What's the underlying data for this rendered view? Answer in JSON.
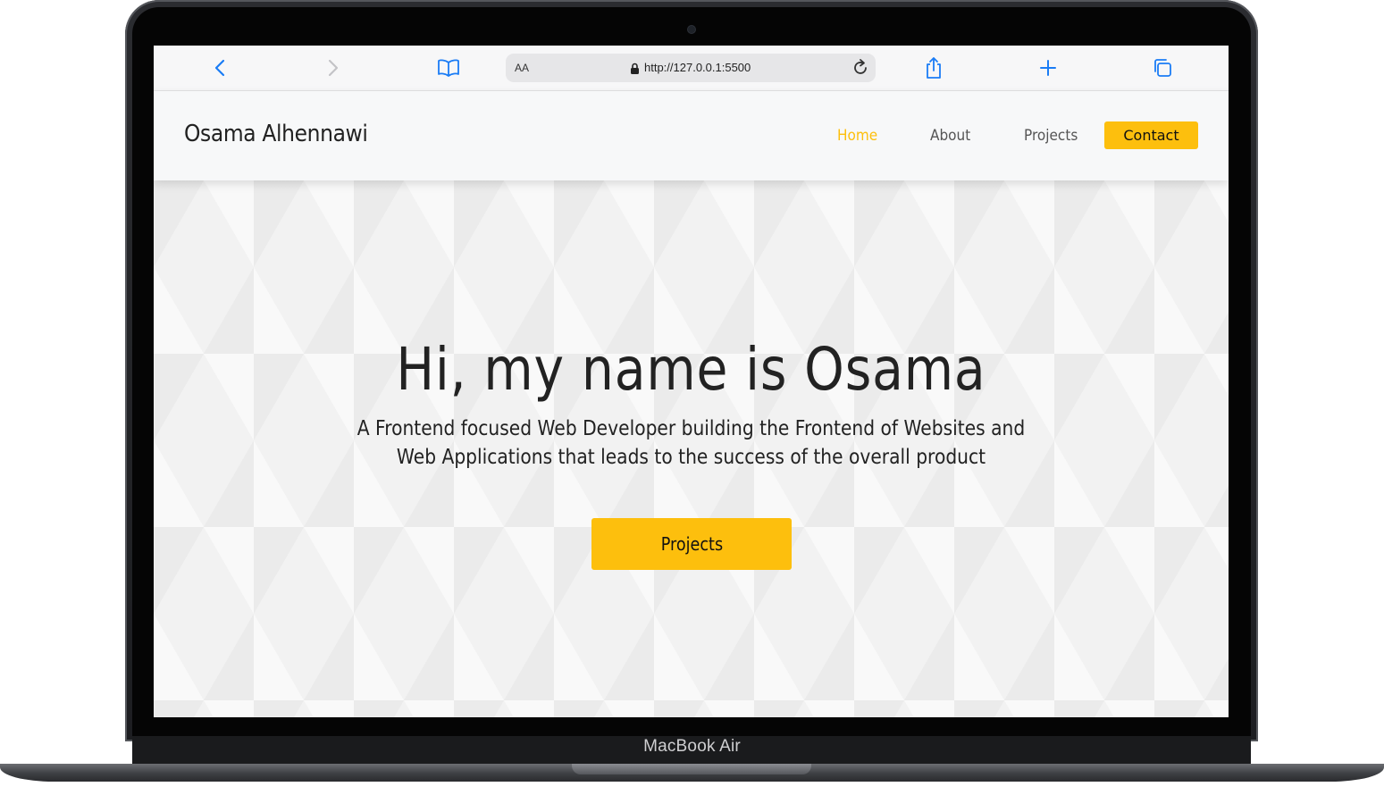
{
  "device": {
    "label": "MacBook Air"
  },
  "browser": {
    "text_size_label": "AA",
    "url": "http://127.0.0.1:5500",
    "icons": [
      "back-icon",
      "forward-icon",
      "bookmarks-icon",
      "lock-icon",
      "reload-icon",
      "share-icon",
      "new-tab-icon",
      "tabs-icon"
    ]
  },
  "site": {
    "brand": "Osama Alhennawi",
    "nav": {
      "home": "Home",
      "about": "About",
      "projects": "Projects",
      "contact": "Contact"
    },
    "hero": {
      "title": "Hi, my name is Osama",
      "subtitle": "A Frontend focused Web Developer building the Frontend of Websites and Web Applications that leads to the success of the overall product",
      "cta": "Projects"
    }
  },
  "colors": {
    "accent": "#fdbf0d",
    "active_nav": "#fdbf0d",
    "nav_text": "#555555",
    "safari_blue": "#1a7cf5"
  }
}
